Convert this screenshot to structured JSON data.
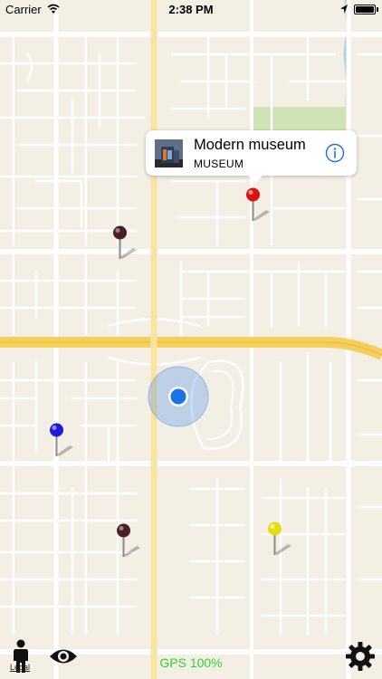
{
  "status_bar": {
    "carrier": "Carrier",
    "time": "2:38 PM",
    "battery_level": 1.0
  },
  "callout": {
    "title": "Modern museum",
    "subtitle": "MUSEUM",
    "thumbnail_icon": "museum-photo",
    "info_icon": "info-icon"
  },
  "pins": [
    {
      "name": "pin-red",
      "color": "#e01010"
    },
    {
      "name": "pin-darkred-1",
      "color": "#4a2026"
    },
    {
      "name": "pin-blue",
      "color": "#1c1cd8"
    },
    {
      "name": "pin-darkred-2",
      "color": "#4a2026"
    },
    {
      "name": "pin-yellow",
      "color": "#e6dd10"
    }
  ],
  "user_location": {
    "color": "#1a73e8"
  },
  "bottom_bar": {
    "legal": "Legal",
    "gps": "GPS 100%",
    "gps_color": "#30d330"
  },
  "colors": {
    "map_background": "#f3efe4",
    "road": "#ffffff",
    "highway": "#f6cf5a",
    "park": "#cfe3b5",
    "water": "#aad3df"
  }
}
